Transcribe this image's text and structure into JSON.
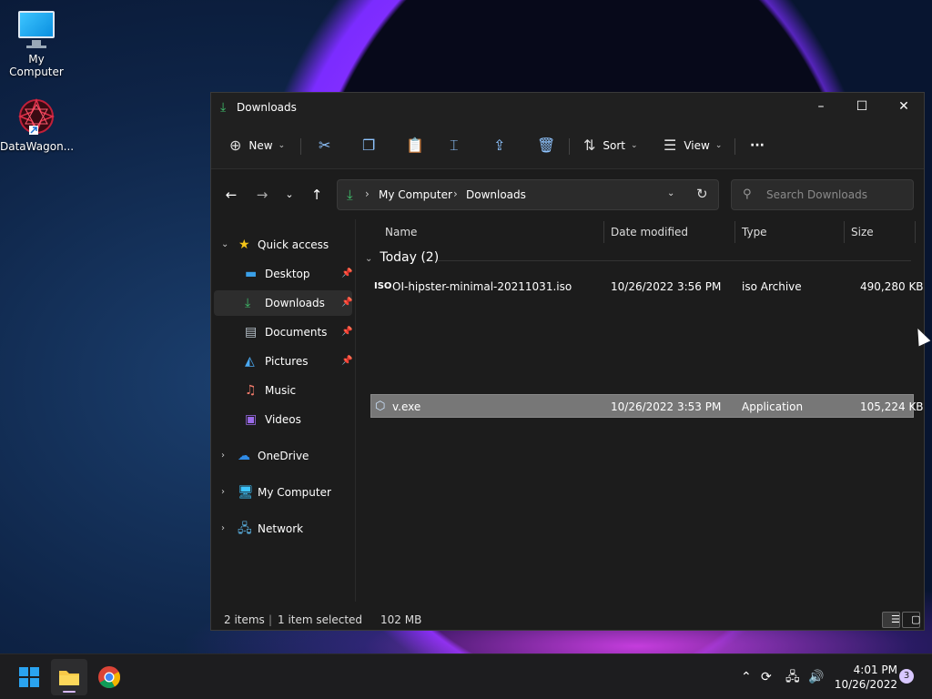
{
  "desktop": {
    "icons": [
      {
        "label": "My Computer",
        "icon": "monitor-icon"
      },
      {
        "label": "DataWagon...",
        "icon": "datawagon-shortcut-icon"
      }
    ]
  },
  "window": {
    "title": "Downloads",
    "controls": {
      "minimize": "–",
      "maximize": "☐",
      "close": "✕"
    },
    "toolbar": {
      "new_label": "New",
      "sort_label": "Sort",
      "view_label": "View",
      "more_label": "···"
    },
    "address": {
      "crumbs": [
        "My Computer",
        "Downloads"
      ],
      "search_placeholder": "Search Downloads"
    },
    "sidebar": {
      "quick_access": "Quick access",
      "items": [
        {
          "label": "Desktop",
          "icon": "desktop-folder-icon",
          "pinned": true
        },
        {
          "label": "Downloads",
          "icon": "download-icon",
          "pinned": true,
          "selected": true
        },
        {
          "label": "Documents",
          "icon": "documents-icon",
          "pinned": true
        },
        {
          "label": "Pictures",
          "icon": "pictures-icon",
          "pinned": true
        },
        {
          "label": "Music",
          "icon": "music-icon",
          "pinned": false
        },
        {
          "label": "Videos",
          "icon": "videos-icon",
          "pinned": false
        }
      ],
      "locations": [
        {
          "label": "OneDrive",
          "icon": "onedrive-icon"
        },
        {
          "label": "My Computer",
          "icon": "computer-icon"
        },
        {
          "label": "Network",
          "icon": "network-icon"
        }
      ]
    },
    "columns": {
      "name": "Name",
      "date": "Date modified",
      "type": "Type",
      "size": "Size"
    },
    "group": {
      "label": "Today (2)"
    },
    "files": [
      {
        "name": "OI-hipster-minimal-20211031.iso",
        "date": "10/26/2022 3:56 PM",
        "type": "iso Archive",
        "size": "490,280 KB",
        "icon": "iso-file-icon"
      },
      {
        "name": "v.exe",
        "date": "10/26/2022 3:53 PM",
        "type": "Application",
        "size": "105,224 KB",
        "icon": "app-file-icon",
        "selected": true
      }
    ],
    "status": {
      "items": "2 items",
      "selected": "1 item selected",
      "size": "102 MB"
    }
  },
  "taskbar": {
    "time": "4:01 PM",
    "date": "10/26/2022",
    "notifications": "3"
  },
  "colors": {
    "accent_green": "#3fbf6b",
    "selection": "#777777",
    "window_bg": "#1c1c1c"
  }
}
